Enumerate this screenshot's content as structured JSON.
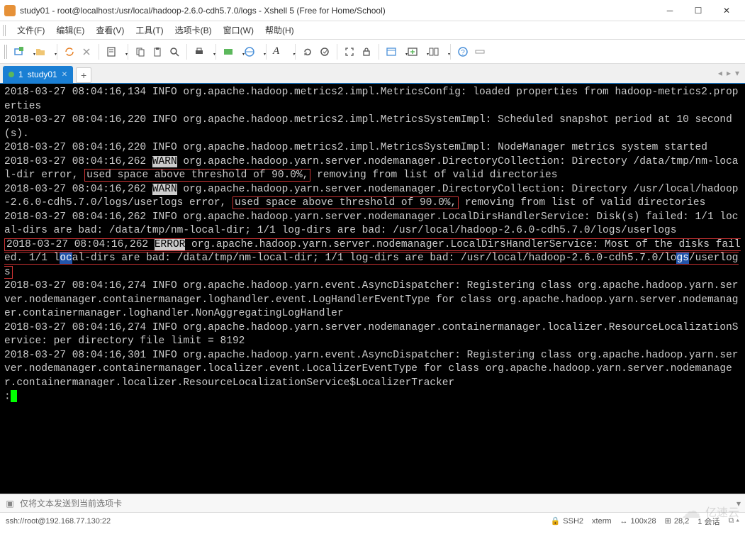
{
  "title": "study01 - root@localhost:/usr/local/hadoop-2.6.0-cdh5.7.0/logs - Xshell 5 (Free for Home/School)",
  "menu": {
    "items": [
      "文件(F)",
      "编辑(E)",
      "查看(V)",
      "工具(T)",
      "选项卡(B)",
      "窗口(W)",
      "帮助(H)"
    ]
  },
  "tab": {
    "index": "1",
    "name": "study01"
  },
  "log": {
    "l1": "2018-03-27 08:04:16,134 INFO org.apache.hadoop.metrics2.impl.MetricsConfig: loaded properties from hadoop-metrics2.properties",
    "l2": "2018-03-27 08:04:16,220 INFO org.apache.hadoop.metrics2.impl.MetricsSystemImpl: Scheduled snapshot period at 10 second(s).",
    "l3": "2018-03-27 08:04:16,220 INFO org.apache.hadoop.metrics2.impl.MetricsSystemImpl: NodeManager metrics system started",
    "l4a": "2018-03-27 08:04:16,262 ",
    "l4warn": "WARN",
    "l4b": " org.apache.hadoop.yarn.server.nodemanager.DirectoryCollection: Directory /data/tmp/nm-local-dir error, ",
    "l4box": "used space above threshold of 90.0%,",
    "l4c": " removing from list of valid directories",
    "l5a": "2018-03-27 08:04:16,262 ",
    "l5warn": "WARN",
    "l5b": " org.apache.hadoop.yarn.server.nodemanager.DirectoryCollection: Directory /usr/local/hadoop-2.6.0-cdh5.7.0/logs/userlogs error, ",
    "l5box": "used space above threshold of 90.0%,",
    "l5c": " removing from list of valid directories",
    "l6": "2018-03-27 08:04:16,262 INFO org.apache.hadoop.yarn.server.nodemanager.LocalDirsHandlerService: Disk(s) failed: 1/1 local-dirs are bad: /data/tmp/nm-local-dir; 1/1 log-dirs are bad: /usr/local/hadoop-2.6.0-cdh5.7.0/logs/userlogs",
    "l7a": "2018-03-27 08:04:16,262 ",
    "l7err": "ERROR",
    "l7b": " org.apache.hadoop.yarn.server.nodemanager.LocalDirsHandlerService: Most of the disks failed. 1/1 l",
    "l7sel": "oc",
    "l7b2": "al-dirs are bad: /data/tmp/nm-local-dir; 1/1 log-dirs are bad: /usr/local/hadoop-2.6.0-cdh5.7.0/lo",
    "l7sel2": "gs",
    "l7b3": "/userlogs",
    "l8": "2018-03-27 08:04:16,274 INFO org.apache.hadoop.yarn.event.AsyncDispatcher: Registering class org.apache.hadoop.yarn.server.nodemanager.containermanager.loghandler.event.LogHandlerEventType for class org.apache.hadoop.yarn.server.nodemanager.containermanager.loghandler.NonAggregatingLogHandler",
    "l9": "2018-03-27 08:04:16,274 INFO org.apache.hadoop.yarn.server.nodemanager.containermanager.localizer.ResourceLocalizationService: per directory file limit = 8192",
    "l10": "2018-03-27 08:04:16,301 INFO org.apache.hadoop.yarn.event.AsyncDispatcher: Registering class org.apache.hadoop.yarn.server.nodemanager.containermanager.localizer.event.LocalizerEventType for class org.apache.hadoop.yarn.server.nodemanager.containermanager.localizer.ResourceLocalizationService$LocalizerTracker",
    "prompt": ":"
  },
  "input_placeholder": "仅将文本发送到当前选项卡",
  "status": {
    "conn": "ssh://root@192.168.77.130:22",
    "ssh": "SSH2",
    "term": "xterm",
    "size": "100x28",
    "pos": "28,2",
    "sess": "1 会话"
  },
  "watermark": "亿速云"
}
